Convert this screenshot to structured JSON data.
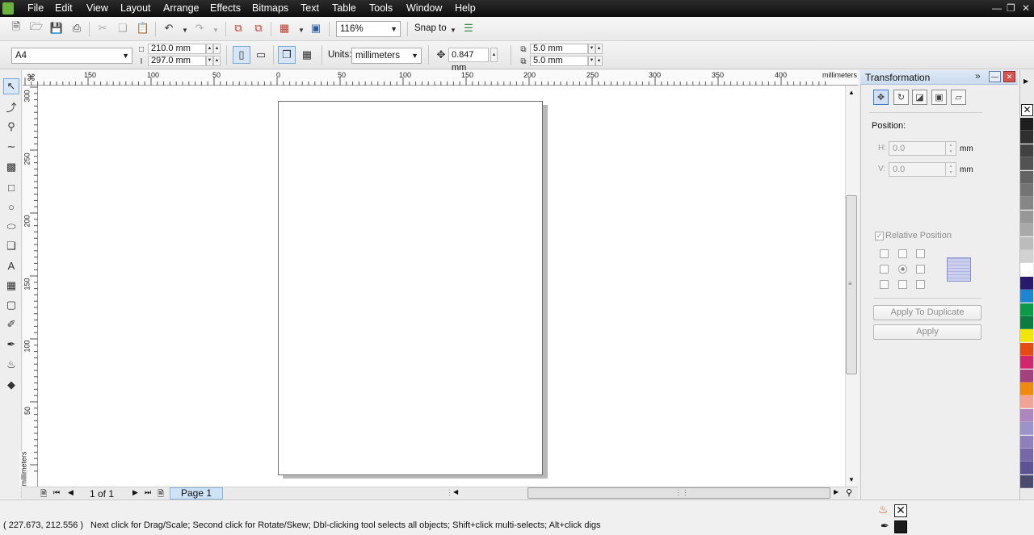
{
  "menubar": {
    "items": [
      "File",
      "Edit",
      "View",
      "Layout",
      "Arrange",
      "Effects",
      "Bitmaps",
      "Text",
      "Table",
      "Tools",
      "Window",
      "Help"
    ]
  },
  "standard_toolbar": {
    "zoom_value": "116%",
    "snap_label": "Snap to"
  },
  "property_bar": {
    "page_size": "A4",
    "page_width": "210.0 mm",
    "page_height": "297.0 mm",
    "units_label": "Units:",
    "units_value": "millimeters",
    "nudge_value": "0.847 mm",
    "dup_x": "5.0 mm",
    "dup_y": "5.0 mm"
  },
  "rulers": {
    "horizontal_ticks": [
      "150",
      "100",
      "50",
      "0",
      "50",
      "100",
      "150",
      "200",
      "250",
      "300",
      "350",
      "400"
    ],
    "horizontal_unit": "millimeters",
    "vertical_ticks": [
      "300",
      "250",
      "200",
      "150",
      "100",
      "50"
    ],
    "vertical_unit": "millimeters"
  },
  "page_nav": {
    "page_count": "1 of 1",
    "page_tab": "Page 1"
  },
  "docker": {
    "title": "Transformation",
    "position_label": "Position:",
    "h_label": "H:",
    "h_value": "0.0",
    "v_label": "V:",
    "v_value": "0.0",
    "unit": "mm",
    "relative_position_label": "Relative Position",
    "apply_to_duplicate": "Apply To Duplicate",
    "apply": "Apply"
  },
  "palette": {
    "colors": [
      "#1e1e1e",
      "#2f2f2f",
      "#414141",
      "#525252",
      "#636363",
      "#747474",
      "#868686",
      "#979797",
      "#a9a9a9",
      "#bcbcbc",
      "#d2d2d2",
      "#ffffff",
      "#2a1a6e",
      "#1e86d1",
      "#0a9a48",
      "#0c7b3f",
      "#f0e60a",
      "#e84a13",
      "#d5256e",
      "#a4417c",
      "#f08a0d",
      "#f2a396",
      "#ad86be",
      "#9c93c9",
      "#8f80bd",
      "#7668a8",
      "#5d5293",
      "#4a4a6e"
    ]
  },
  "statusbar": {
    "coordinates": "( 227.673, 212.556 )",
    "hint": "Next click for Drag/Scale; Second click for Rotate/Skew; Dbl-clicking tool selects all objects; Shift+click multi-selects; Alt+click digs"
  }
}
